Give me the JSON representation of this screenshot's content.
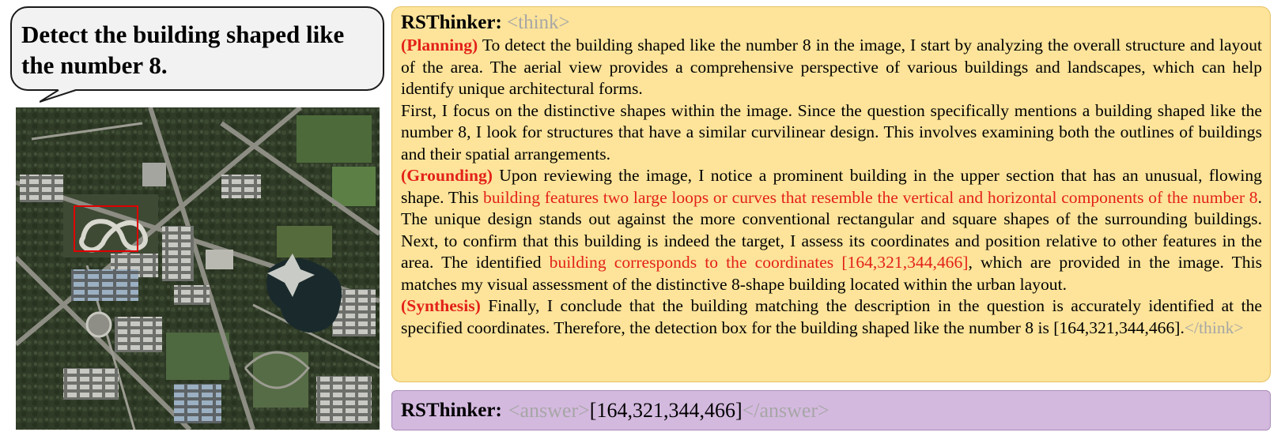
{
  "question": {
    "text": "Detect the building shaped like the number 8."
  },
  "image": {
    "description_icon": "aerial-satellite-image",
    "box_color": "#e00000"
  },
  "think": {
    "speaker": "RSThinker:",
    "open_tag": "<think>",
    "close_tag": "</think>",
    "planning_label": "(Planning)",
    "planning_p1": "To detect the building shaped like the number 8 in the image, I start by analyzing the overall structure and layout of the area. The aerial view provides a comprehensive perspective of various buildings and landscapes, which can help identify unique architectural forms.",
    "planning_p2": "First, I focus on the distinctive shapes within the image. Since the question specifically mentions a building shaped like the number 8, I look for structures that have a similar curvilinear design. This involves examining both the outlines of buildings and their spatial arrangements.",
    "grounding_label": "(Grounding)",
    "grounding_t1": "Upon reviewing the image, I notice a prominent building in the upper section that has an unusual, flowing shape. This ",
    "grounding_hl1": "building features two large loops or curves that resemble the vertical and horizontal components of the number 8",
    "grounding_t2": ". The unique design stands out against the more conventional rectangular and square shapes of the surrounding buildings. Next, to confirm that this building is indeed the target, I assess its coordinates and position relative to other features in the area. The identified ",
    "grounding_hl2": "building corresponds to the coordinates [164,321,344,466]",
    "grounding_t3": ", which are provided in the image. This matches my visual assessment of the distinctive 8-shape building located within the urban layout.",
    "synthesis_label": "(Synthesis)",
    "synthesis_text": "Finally, I conclude that the building matching the description in the question is accurately identified at the specified coordinates. Therefore, the detection box for the building shaped like the number 8 is [164,321,344,466].",
    "panel_color": "#fde49a",
    "highlight_color": "#e32119"
  },
  "answer": {
    "speaker": "RSThinker:",
    "open_tag": "<answer>",
    "value": "[164,321,344,466]",
    "close_tag": "</answer>",
    "panel_color": "#d4b9df"
  }
}
